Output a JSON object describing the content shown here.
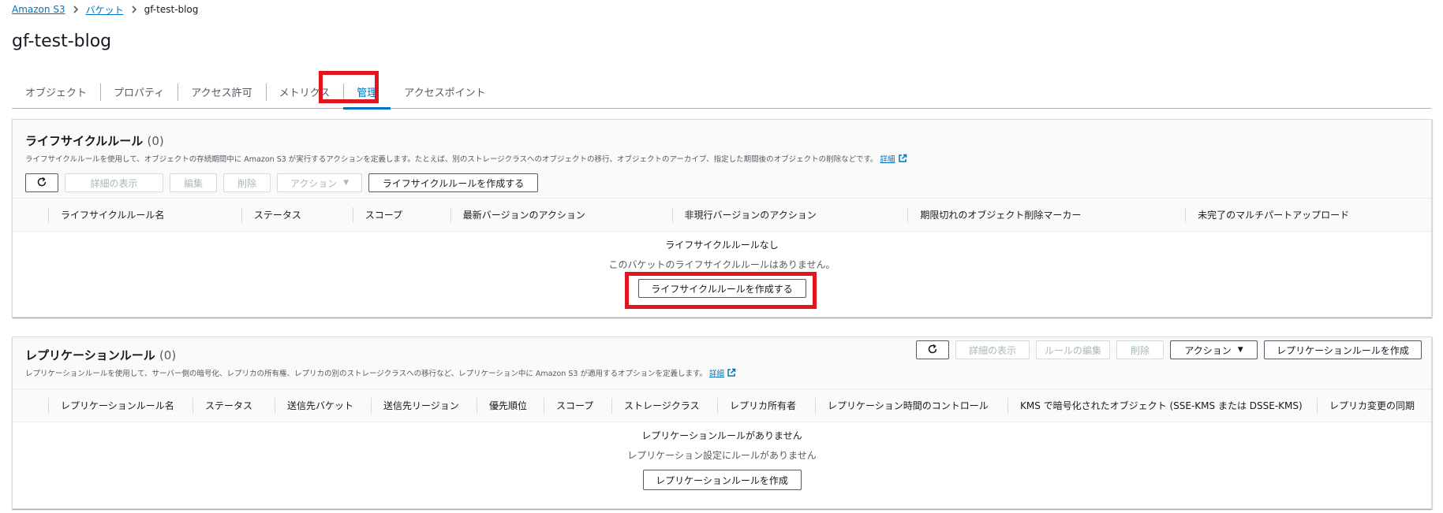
{
  "breadcrumb": {
    "items": [
      "Amazon S3",
      "バケット"
    ],
    "current": "gf-test-blog"
  },
  "page_title": "gf-test-blog",
  "tabs": [
    {
      "label": "オブジェクト",
      "active": false
    },
    {
      "label": "プロパティ",
      "active": false
    },
    {
      "label": "アクセス許可",
      "active": false
    },
    {
      "label": "メトリクス",
      "active": false
    },
    {
      "label": "管理",
      "active": true
    },
    {
      "label": "アクセスポイント",
      "active": false
    }
  ],
  "lifecycle": {
    "title": "ライフサイクルルール",
    "count": "(0)",
    "description": "ライフサイクルルールを使用して、オブジェクトの存続期間中に Amazon S3 が実行するアクションを定義します。たとえば、別のストレージクラスへのオブジェクトの移行、オブジェクトのアーカイブ、指定した期間後のオブジェクトの削除などです。",
    "details_link": "詳細",
    "toolbar": {
      "view_details": "詳細の表示",
      "edit": "編集",
      "delete": "削除",
      "actions": "アクション",
      "create": "ライフサイクルルールを作成する"
    },
    "columns": [
      "ライフサイクルルール名",
      "ステータス",
      "スコープ",
      "最新バージョンのアクション",
      "非現行バージョンのアクション",
      "期限切れのオブジェクト削除マーカー",
      "未完了のマルチパートアップロード"
    ],
    "empty_title": "ライフサイクルルールなし",
    "empty_desc": "このバケットのライフサイクルルールはありません。",
    "empty_button": "ライフサイクルルールを作成する"
  },
  "replication": {
    "title": "レプリケーションルール",
    "count": "(0)",
    "description": "レプリケーションルールを使用して、サーバー側の暗号化、レプリカの所有権、レプリカの別のストレージクラスへの移行など、レプリケーション中に Amazon S3 が適用するオプションを定義します。",
    "details_link": "詳細",
    "toolbar": {
      "view_details": "詳細の表示",
      "edit_rule": "ルールの編集",
      "delete": "削除",
      "actions": "アクション",
      "create": "レプリケーションルールを作成"
    },
    "columns": [
      "レプリケーションルール名",
      "ステータス",
      "送信先バケット",
      "送信先リージョン",
      "優先順位",
      "スコープ",
      "ストレージクラス",
      "レプリカ所有者",
      "レプリケーション時間のコントロール",
      "KMS で暗号化されたオブジェクト (SSE-KMS または DSSE-KMS)",
      "レプリカ変更の同期"
    ],
    "empty_title": "レプリケーションルールがありません",
    "empty_desc": "レプリケーション設定にルールがありません",
    "empty_button": "レプリケーションルールを作成"
  },
  "colors": {
    "link": "#0073bb",
    "highlight": "#e0161f",
    "border": "#d5dbdb"
  }
}
